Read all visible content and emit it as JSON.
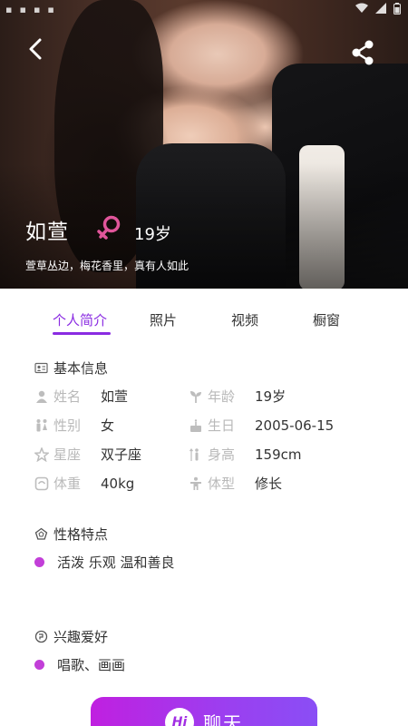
{
  "profile": {
    "name": "如萱",
    "age": "19岁",
    "tagline": "萱草丛边，梅花香里，真有人如此"
  },
  "tabs": [
    {
      "label": "个人简介",
      "active": true
    },
    {
      "label": "照片",
      "active": false
    },
    {
      "label": "视频",
      "active": false
    },
    {
      "label": "橱窗",
      "active": false
    }
  ],
  "basic_info": {
    "title": "基本信息",
    "rows": [
      {
        "icon": "person-icon",
        "label": "姓名",
        "value": "如萱"
      },
      {
        "icon": "sprout-icon",
        "label": "年龄",
        "value": "19岁"
      },
      {
        "icon": "gender-pair-icon",
        "label": "性别",
        "value": "女"
      },
      {
        "icon": "cake-icon",
        "label": "生日",
        "value": "2005-06-15"
      },
      {
        "icon": "star-icon",
        "label": "星座",
        "value": "双子座"
      },
      {
        "icon": "height-icon",
        "label": "身高",
        "value": "159cm"
      },
      {
        "icon": "scale-icon",
        "label": "体重",
        "value": "40kg"
      },
      {
        "icon": "body-icon",
        "label": "体型",
        "value": "修长"
      }
    ]
  },
  "personality": {
    "title": "性格特点",
    "items": [
      "活泼 乐观 温和善良"
    ]
  },
  "hobbies": {
    "title": "兴趣爱好",
    "items": [
      "唱歌、画画"
    ]
  },
  "chat_button": {
    "badge": "Hi",
    "label": "聊天"
  },
  "colors": {
    "accent": "#8a2be2",
    "bullet": "#c23fd8",
    "gender_icon": "#e0559a",
    "label_gray": "#b9b9b9"
  }
}
